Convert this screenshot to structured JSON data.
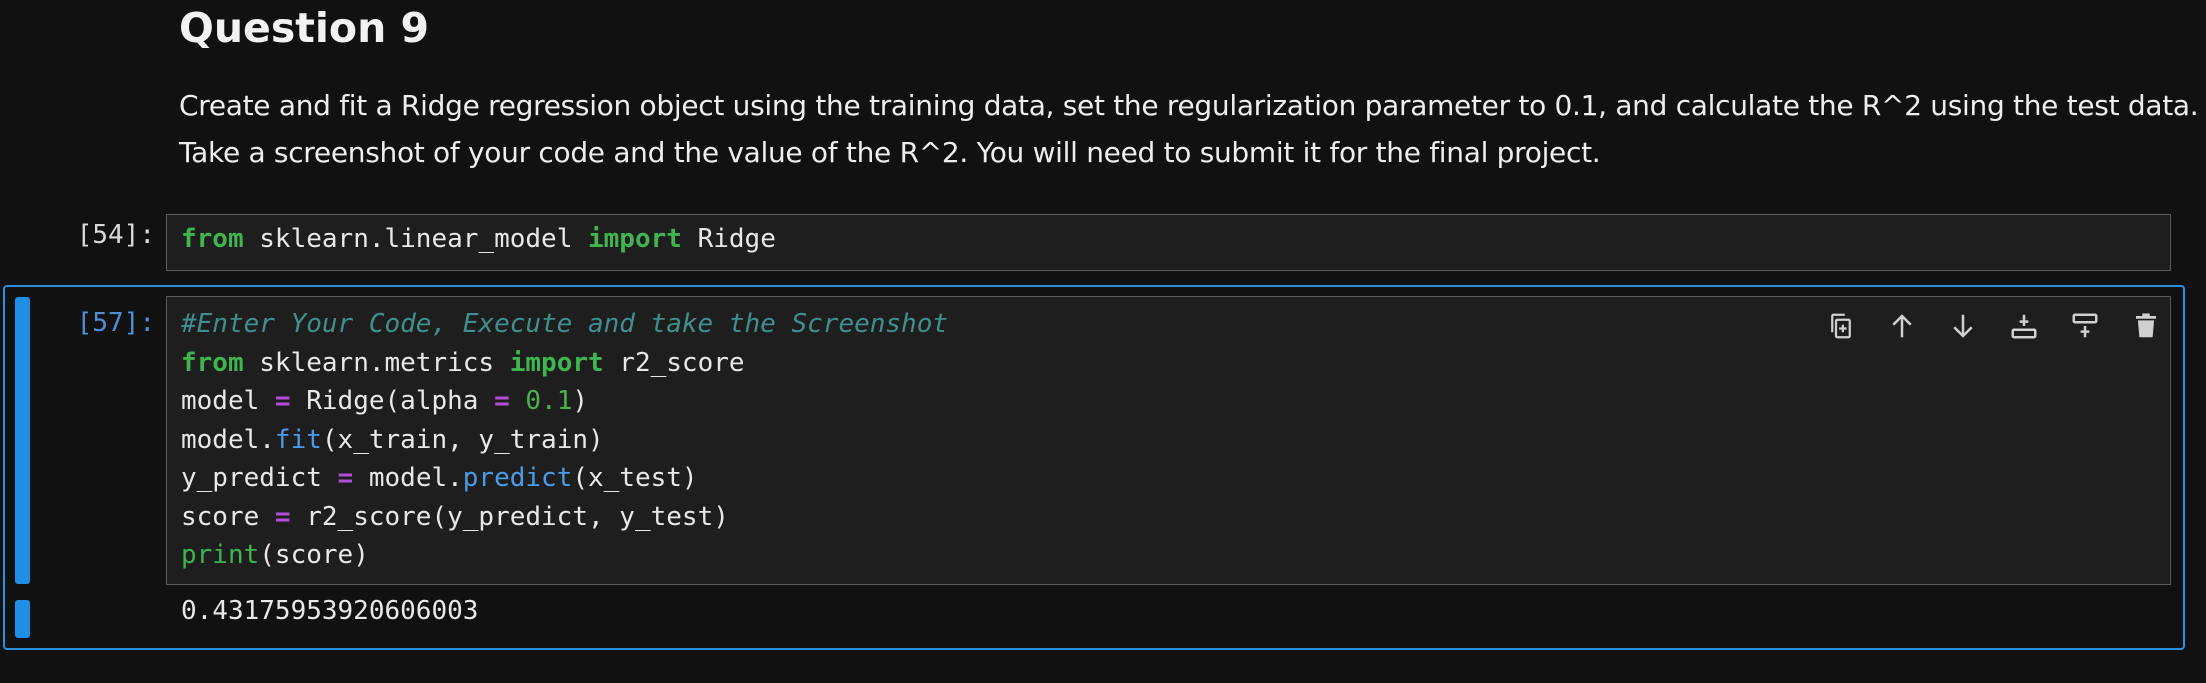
{
  "markdown": {
    "heading": "Question 9",
    "paragraph1": "Create and fit a Ridge regression object using the training data, set the regularization parameter to 0.1, and calculate the R^2 using the test data.",
    "paragraph2": "Take a screenshot of your code and the value of the R^2. You will need to submit it for the final project."
  },
  "cells": [
    {
      "prompt": "[54]:",
      "code": {
        "kw_from": "from",
        "module": " sklearn.linear_model ",
        "kw_import": "import",
        "name": " Ridge"
      }
    },
    {
      "prompt": "[57]:",
      "lines": {
        "comment": "#Enter Your Code, Execute and take the Screenshot",
        "l2_from": "from",
        "l2_module": " sklearn.metrics ",
        "l2_import": "import",
        "l2_name": " r2_score",
        "l3_a": "model ",
        "l3_op": "=",
        "l3_b": " Ridge(alpha ",
        "l3_op2": "=",
        "l3_sp": " ",
        "l3_num": "0.1",
        "l3_c": ")",
        "l4_a": "model.",
        "l4_fn": "fit",
        "l4_b": "(x_train, y_train)",
        "l5_a": "y_predict ",
        "l5_op": "=",
        "l5_b": " model.",
        "l5_fn": "predict",
        "l5_c": "(x_test)",
        "l6_a": "score ",
        "l6_op": "=",
        "l6_b": " r2_score(y_predict, y_test)",
        "l7_fn": "print",
        "l7_b": "(score)"
      },
      "output": "0.43175953920606003"
    }
  ],
  "toolbar": {
    "icons": [
      "duplicate-icon",
      "move-up-icon",
      "move-down-icon",
      "insert-above-icon",
      "insert-below-icon",
      "delete-icon"
    ]
  },
  "colors": {
    "background": "#111111",
    "cell_background": "#1e1e1e",
    "selection_border": "#2b8fe0",
    "keyword": "#3fb44f",
    "comment": "#3f8f8f",
    "operator": "#b14fd8",
    "function": "#4c9be8"
  }
}
